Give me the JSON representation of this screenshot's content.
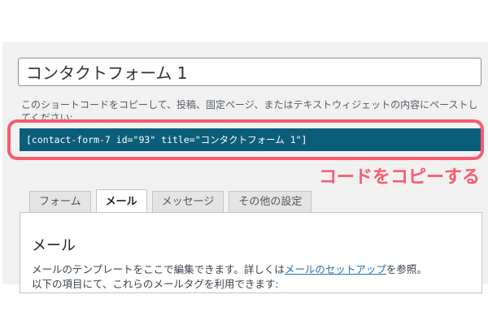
{
  "form": {
    "title_value": "コンタクトフォーム 1",
    "description": "このショートコードをコピーして、投稿、固定ページ、またはテキストウィジェットの内容にペーストしてください:",
    "shortcode": "[contact-form-7 id=\"93\" title=\"コンタクトフォーム 1\"]"
  },
  "annotation": {
    "text": "コードをコピーする",
    "color": "#f75c6e"
  },
  "tabs": [
    {
      "label": "フォーム",
      "active": false
    },
    {
      "label": "メール",
      "active": true
    },
    {
      "label": "メッセージ",
      "active": false
    },
    {
      "label": "その他の設定",
      "active": false
    }
  ],
  "mail_panel": {
    "heading": "メール",
    "text_before_link": "メールのテンプレートをここで編集できます。詳しくは",
    "link_text": "メールのセットアップ",
    "text_after_link": "を参照。",
    "line2": "以下の項目にて、これらのメールタグを利用できます:"
  },
  "colors": {
    "shortcode_bg": "#0b5e7a",
    "link": "#2271b1",
    "screen_bg": "#f1f1f1"
  }
}
